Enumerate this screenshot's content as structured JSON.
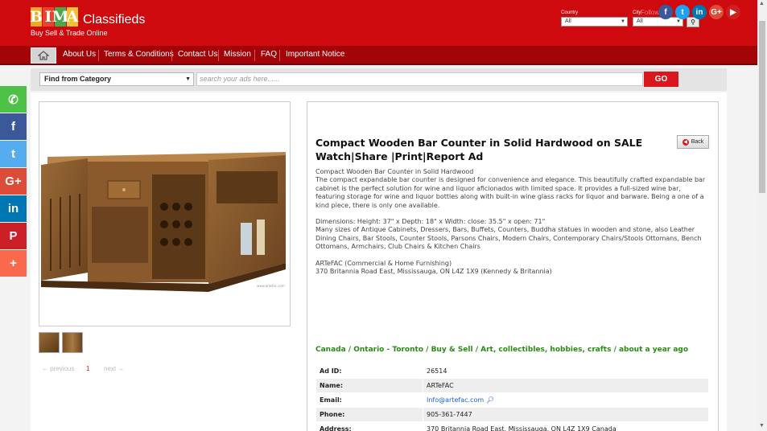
{
  "brand": {
    "logo_letters": [
      "B",
      "I",
      "M",
      "A"
    ],
    "logo_colors": [
      "#f5a623",
      "#e8432d",
      "#4aa84a",
      "#f2c230"
    ],
    "name": "Classifieds",
    "tagline": "Buy Sell & Trade Online"
  },
  "filters": {
    "country_label": "Country",
    "country_value": "All",
    "city_label": "City",
    "city_value": "All"
  },
  "social_header": {
    "follow_label": "Follow",
    "icons": [
      {
        "name": "facebook-icon",
        "glyph": "f",
        "color": "#3b5998"
      },
      {
        "name": "twitter-icon",
        "glyph": "t",
        "color": "#1da1f2"
      },
      {
        "name": "linkedin-icon",
        "glyph": "in",
        "color": "#0077b5"
      },
      {
        "name": "googleplus-icon",
        "glyph": "G+",
        "color": "#dd4b39"
      },
      {
        "name": "youtube-icon",
        "glyph": "▶",
        "color": "#cd201f"
      }
    ]
  },
  "nav": {
    "items": [
      "About Us",
      "Terms & Conditions",
      "Contact Us",
      "Mission",
      "FAQ",
      "Important Notice"
    ]
  },
  "search": {
    "category_label": "Find from Category",
    "placeholder": "search your ads here......",
    "go_label": "GO"
  },
  "gallery": {
    "pager_prev": "← previous",
    "pager_current": "1",
    "pager_next": "next →"
  },
  "listing": {
    "title": "Compact Wooden Bar Counter in Solid Hardwood on SALE Watch|Share |Print|Report Ad",
    "back_label": "Back",
    "description": [
      " Compact Wooden Bar Counter in Solid Hardwood",
      "The compact expandable bar counter is designed for convenience and elegance. This beautifully crafted expandable bar cabinet is the perfect solution for wine and liquor aficionados with limited space. It provides a full-sized wine bar, featuring storage for wine and liquor bottles along with built-in wine glass racks for liquor and barware. Being a one of a kind piece, there is only one available.",
      "Dimensions: Height: 37\" x Depth: 18\" x Width: close: 35.5\" x open: 71\"",
      "Many sizes of Antique Cabinets, Dressers, Bars, Buffets, Counters, Buddha statues in wooden and stone, also Leather Dining Chairs, Bar Stools, Counter Stools, Parsons Chairs, Modern Chairs, Contemporary Chairs/Stools Ottomans, Bench Ottomans, Armchairs, Club Chairs & Kitchen Chairs",
      "ARTeFAC (Commercial & Home Furnishing)",
      "370 Britannia Road East, Mississauga, ON L4Z 1X9 (Kennedy & Britannia)"
    ],
    "breadcrumb": "Canada / Ontario - Toronto / Buy & Sell / Art, collectibles, hobbies, crafts / about a year ago",
    "details": {
      "ad_id_label": "Ad ID:",
      "ad_id": "26514",
      "name_label": "Name:",
      "name": "ARTeFAC",
      "email_label": "Email:",
      "email": "Info@artefac.com",
      "phone_label": "Phone:",
      "phone": "905-361-7447",
      "address_label": "Address:",
      "address": "370 Britannia Road East, Mississauga, ON L4Z 1X9 Canada"
    }
  },
  "share_bar": [
    {
      "name": "whatsapp-share-icon",
      "glyph": "✆",
      "color": "#4dc247"
    },
    {
      "name": "facebook-share-icon",
      "glyph": "f",
      "color": "#3b5998"
    },
    {
      "name": "twitter-share-icon",
      "glyph": "t",
      "color": "#55acee"
    },
    {
      "name": "googleplus-share-icon",
      "glyph": "G+",
      "color": "#dd4b39"
    },
    {
      "name": "linkedin-share-icon",
      "glyph": "in",
      "color": "#0077b5"
    },
    {
      "name": "pinterest-share-icon",
      "glyph": "P",
      "color": "#cb2027"
    },
    {
      "name": "more-share-icon",
      "glyph": "+",
      "color": "#f8694d"
    }
  ],
  "colors": {
    "header_red": "#cf0a0f",
    "nav_red": "#a20407",
    "go_red": "#d9171c",
    "breadcrumb_green": "#2a8a16"
  }
}
